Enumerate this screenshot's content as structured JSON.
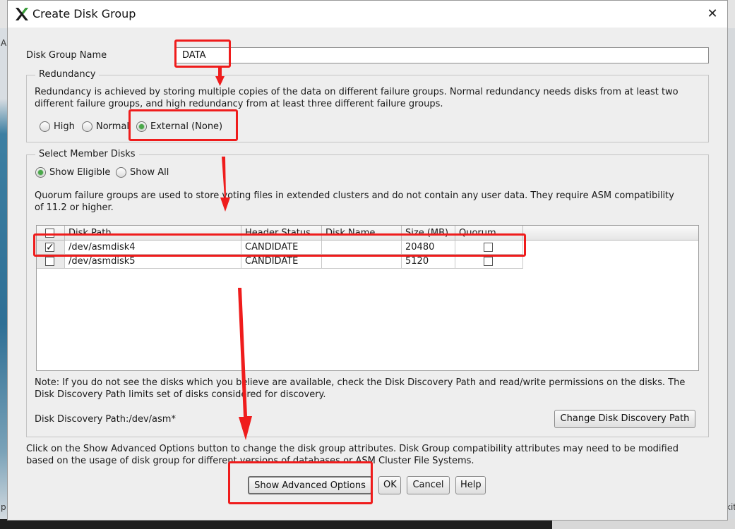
{
  "dialog": {
    "title": "Create Disk Group",
    "close_symbol": "✕"
  },
  "disk_group_name": {
    "label": "Disk Group Name",
    "value": "DATA"
  },
  "redundancy": {
    "legend": "Redundancy",
    "description_line1": "Redundancy is achieved by storing multiple copies of the data on different failure groups. Normal redundancy needs disks from at least two",
    "description_line2": "different failure groups, and high redundancy from at least three different failure groups.",
    "options": [
      {
        "label": "High",
        "selected": false
      },
      {
        "label": "Normal",
        "selected": false
      },
      {
        "label": "External (None)",
        "selected": true
      }
    ]
  },
  "member_disks": {
    "legend": "Select Member Disks",
    "filter_options": [
      {
        "label": "Show Eligible",
        "selected": true
      },
      {
        "label": "Show All",
        "selected": false
      }
    ],
    "quorum_note_line1": "Quorum failure groups are used to store voting files in extended clusters and do not contain any user data. They require ASM compatibility",
    "quorum_note_line2": "of 11.2 or higher.",
    "table": {
      "columns": [
        "",
        "Disk Path",
        "Header Status",
        "Disk Name",
        "Size (MB)",
        "Quorum"
      ],
      "rows": [
        {
          "selected": true,
          "disk_path": "/dev/asmdisk4",
          "header_status": "CANDIDATE",
          "disk_name": "",
          "size_mb": "20480",
          "quorum": false
        },
        {
          "selected": false,
          "disk_path": "/dev/asmdisk5",
          "header_status": "CANDIDATE",
          "disk_name": "",
          "size_mb": "5120",
          "quorum": false
        }
      ]
    },
    "discovery_note_line1": "Note: If you do not see the disks which you believe are available, check the Disk Discovery Path and read/write permissions on the disks. The",
    "discovery_note_line2": "Disk Discovery Path limits set of disks considered for discovery.",
    "discovery_path": "Disk Discovery Path:/dev/asm*",
    "change_path_button": "Change Disk Discovery Path"
  },
  "advanced_note_line1": "Click on the Show Advanced Options button to change the disk group attributes. Disk Group compatibility attributes may need to be modified",
  "advanced_note_line2": "based on the usage of disk group for different versions of databases or ASM Cluster File Systems.",
  "buttons": {
    "advanced": "Show Advanced Options",
    "ok": "OK",
    "cancel": "Cancel",
    "help": "Help"
  },
  "background_edge_text": {
    "left_top": "A",
    "left_bottom": "p",
    "right_bottom": "kit"
  },
  "colors": {
    "annotation": "#ef1c1c",
    "radio_selected": "#4aa84a",
    "dialog_bg": "#eeeeee"
  }
}
